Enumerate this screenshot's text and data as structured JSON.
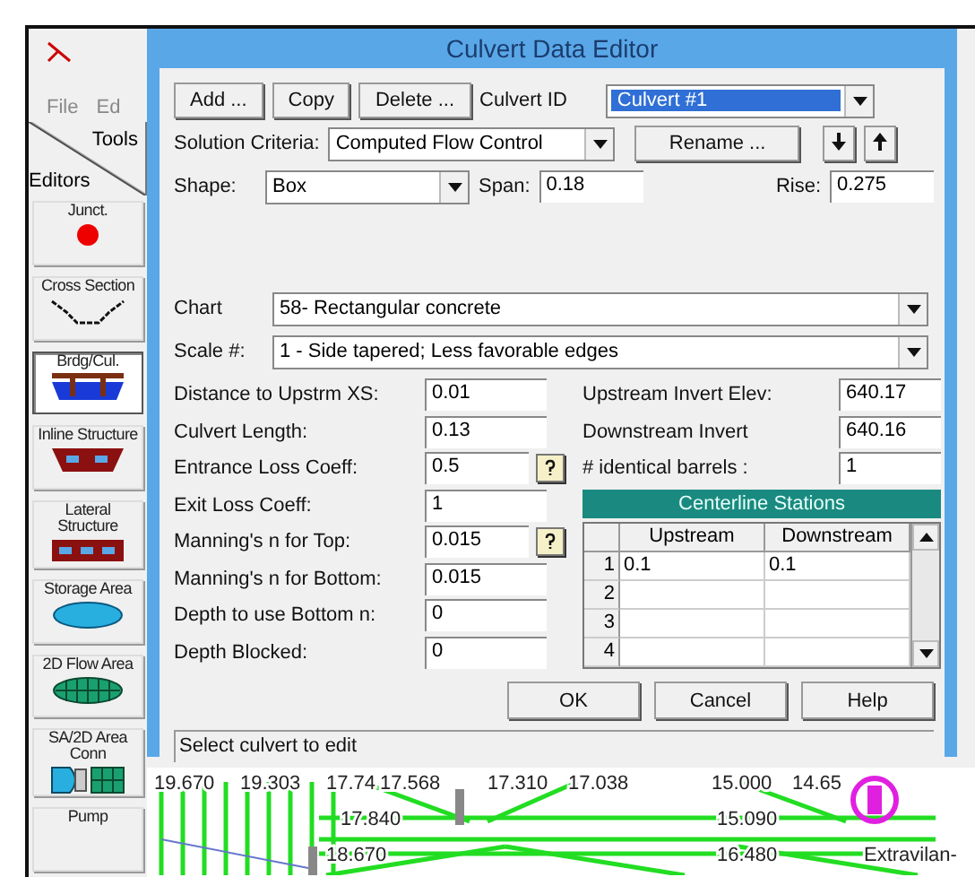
{
  "app": {
    "menu": [
      "File",
      "Ed"
    ],
    "tools_label": "Tools",
    "editors_label": "Editors",
    "editors": [
      {
        "label": "Junct.",
        "kind": "junction",
        "selected": false
      },
      {
        "label": "Cross Section",
        "kind": "cross",
        "selected": false
      },
      {
        "label": "Brdg/Cul.",
        "kind": "bridge",
        "selected": true
      },
      {
        "label": "Inline Structure",
        "kind": "inline",
        "selected": false
      },
      {
        "label": "Lateral Structure",
        "kind": "lateral",
        "selected": false
      },
      {
        "label": "Storage Area",
        "kind": "storage",
        "selected": false
      },
      {
        "label": "2D Flow Area",
        "kind": "flow2d",
        "selected": false
      },
      {
        "label": "SA/2D Area Conn",
        "kind": "conn",
        "selected": false
      },
      {
        "label": "Pump",
        "kind": "pump",
        "selected": false
      }
    ]
  },
  "dialog": {
    "title": "Culvert Data Editor",
    "buttons": [
      "Add ...",
      "Copy",
      "Delete ..."
    ],
    "culvert_id": {
      "label": "Culvert ID",
      "value": "Culvert #1"
    },
    "solution": {
      "label": "Solution Criteria:",
      "value": "Computed Flow Control"
    },
    "rename": "Rename ...",
    "shape": {
      "label": "Shape:",
      "value": "Box"
    },
    "span": {
      "label": "Span:",
      "value": "0.18"
    },
    "rise": {
      "label": "Rise:",
      "value": "0.275"
    },
    "chart": {
      "label": "Chart",
      "value": "58- Rectangular concrete"
    },
    "scale": {
      "label": "Scale #:",
      "value": "1 - Side tapered; Less favorable edges"
    },
    "left_fields": [
      {
        "label": "Distance to Upstrm XS:",
        "value": "0.01",
        "help": false
      },
      {
        "label": "Culvert Length:",
        "value": "0.13",
        "help": false
      },
      {
        "label": "Entrance Loss Coeff:",
        "value": "0.5",
        "help": true
      },
      {
        "label": "Exit Loss Coeff:",
        "value": "1",
        "help": false
      },
      {
        "label": "Manning's n for Top:",
        "value": "0.015",
        "help": true
      },
      {
        "label": "Manning's n for Bottom:",
        "value": "0.015",
        "help": false
      },
      {
        "label": "Depth to use Bottom n:",
        "value": "0",
        "help": false
      },
      {
        "label": "Depth Blocked:",
        "value": "0",
        "help": false
      }
    ],
    "right_fields": [
      {
        "label": "Upstream Invert Elev:",
        "value": "640.17"
      },
      {
        "label": "Downstream Invert",
        "value": "640.16"
      },
      {
        "label": "# identical barrels :",
        "value": "1"
      }
    ],
    "centerline": {
      "title": "Centerline Stations",
      "columns": [
        "Upstream",
        "Downstream"
      ],
      "rows": [
        {
          "number": "1",
          "upstream": "0.1",
          "downstream": "0.1"
        },
        {
          "number": "2"
        },
        {
          "number": "3"
        },
        {
          "number": "4"
        }
      ]
    },
    "actions": [
      "OK",
      "Cancel",
      "Help"
    ],
    "status": "Select culvert to edit"
  },
  "map": {
    "labels": [
      "19.670",
      "19.303",
      "17.74",
      "17.568",
      "17.310",
      "17.038",
      "15.000",
      "14.65",
      "17.840",
      "15.090",
      "18.670",
      "16.480",
      "Extravilan-"
    ]
  }
}
